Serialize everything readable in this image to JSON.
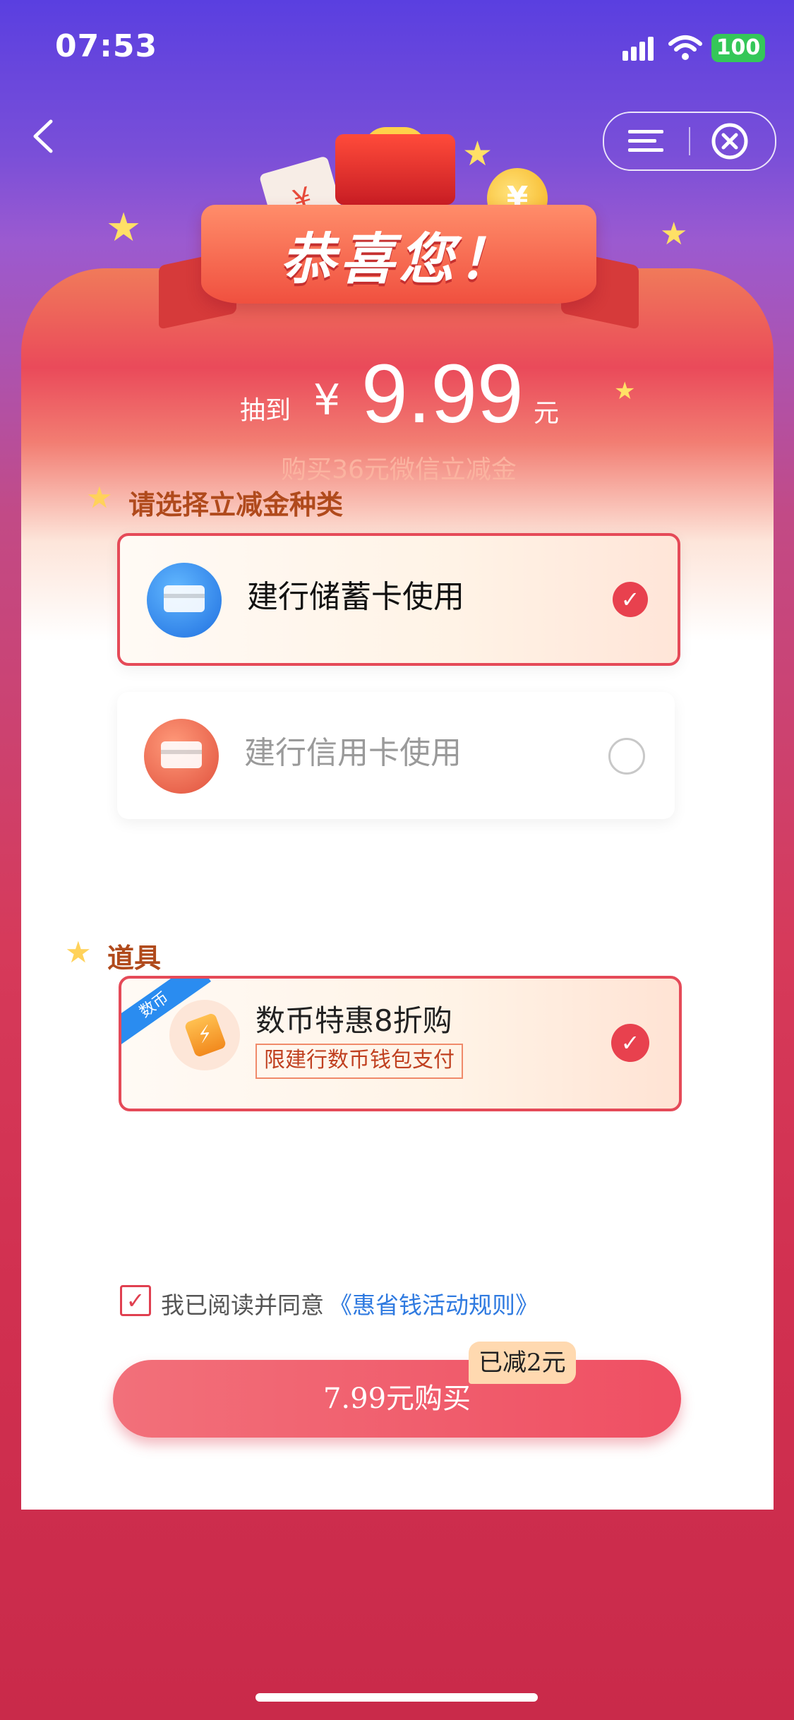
{
  "status_bar": {
    "time": "07:53",
    "battery": "100"
  },
  "banner": {
    "title": "恭喜您！",
    "envelope_glyph": "¥",
    "coin_glyph": "¥"
  },
  "prize": {
    "prefix": "抽到",
    "currency": "¥",
    "amount": "9.99",
    "unit": "元",
    "subtitle": "购买36元微信立减金"
  },
  "voucher_section": {
    "title": "请选择立减金种类",
    "options": [
      {
        "label": "建行储蓄卡使用",
        "selected": true
      },
      {
        "label": "建行信用卡使用",
        "selected": false
      }
    ]
  },
  "tools_section": {
    "title": "道具",
    "tool": {
      "badge": "数币",
      "title": "数币特惠8折购",
      "note": "限建行数币钱包支付",
      "selected": true
    }
  },
  "agreement": {
    "text": "我已阅读并同意",
    "link": "《惠省钱活动规则》",
    "checked": true
  },
  "purchase": {
    "label": "7.99元购买",
    "discount_badge": "已减2元"
  },
  "colors": {
    "accent": "#e8414e",
    "link": "#2f7ae0",
    "tool_badge": "#2a8cf0"
  }
}
